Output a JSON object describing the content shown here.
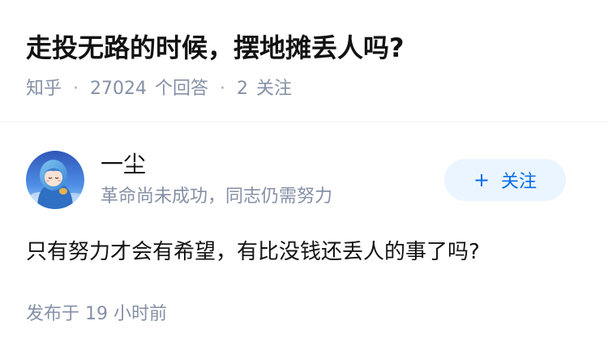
{
  "question": {
    "title": "走投无路的时候，摆地摊丢人吗?",
    "source": "知乎",
    "answer_count": "27024",
    "answer_count_suffix": "个回答",
    "follower_count": "2",
    "follower_suffix": "关注",
    "separator": "·"
  },
  "answer": {
    "author": {
      "name": "一尘",
      "bio": "革命尚未成功，同志仍需努力",
      "avatar_icon": "anime-avatar-icon"
    },
    "follow_button": {
      "plus": "+",
      "label": "关注"
    },
    "content": "只有努力才会有希望，有比没钱还丢人的事了吗?",
    "published": "发布于",
    "published_time": "19 小时前"
  },
  "colors": {
    "title": "#121212",
    "meta": "#8590a6",
    "accent": "#056de8",
    "follow_bg": "#ebf5ff",
    "divider": "#f0f2f7"
  }
}
